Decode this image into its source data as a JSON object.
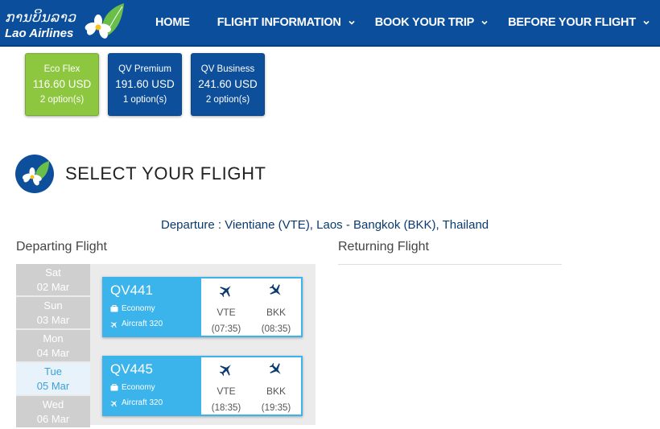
{
  "header": {
    "logo_script": "ການບິນລາວ",
    "logo_name": "Lao Airlines",
    "nav": [
      {
        "label": "HOME",
        "dropdown": false
      },
      {
        "label": "FLIGHT INFORMATION",
        "dropdown": true
      },
      {
        "label": "BOOK YOUR TRIP",
        "dropdown": true
      },
      {
        "label": "BEFORE YOUR FLIGHT",
        "dropdown": true
      }
    ]
  },
  "fares": [
    {
      "name": "Eco Flex",
      "price": "116.60 USD",
      "options": "2 option(s)",
      "color": "#8dc63f"
    },
    {
      "name": "QV Premium",
      "price": "191.60 USD",
      "options": "1 option(s)",
      "color": "#0d4f9a"
    },
    {
      "name": "QV Business",
      "price": "241.60 USD",
      "options": "2 option(s)",
      "color": "#0d4f9a"
    }
  ],
  "section": {
    "title": "SELECT YOUR FLIGHT"
  },
  "route": "Departure : Vientiane (VTE), Laos - Bangkok (BKK), Thailand",
  "departing_label": "Departing Flight",
  "returning_label": "Returning Flight",
  "dates": [
    {
      "day": "Sat",
      "date": "02 Mar",
      "active": false
    },
    {
      "day": "Sun",
      "date": "03 Mar",
      "active": false
    },
    {
      "day": "Mon",
      "date": "04 Mar",
      "active": false
    },
    {
      "day": "Tue",
      "date": "05 Mar",
      "active": true
    },
    {
      "day": "Wed",
      "date": "06 Mar",
      "active": false
    }
  ],
  "flights": [
    {
      "code": "QV441",
      "cabin": "Economy",
      "aircraft": "Aircraft 320",
      "from": "VTE",
      "to": "BKK",
      "dep_time": "(07:35)",
      "arr_time": "(08:35)"
    },
    {
      "code": "QV445",
      "cabin": "Economy",
      "aircraft": "Aircraft 320",
      "from": "VTE",
      "to": "BKK",
      "dep_time": "(18:35)",
      "arr_time": "(19:35)"
    }
  ],
  "colors": {
    "brand": "#0b4f9c",
    "accent": "#3bb4ec",
    "fare_green": "#8dc63f"
  }
}
